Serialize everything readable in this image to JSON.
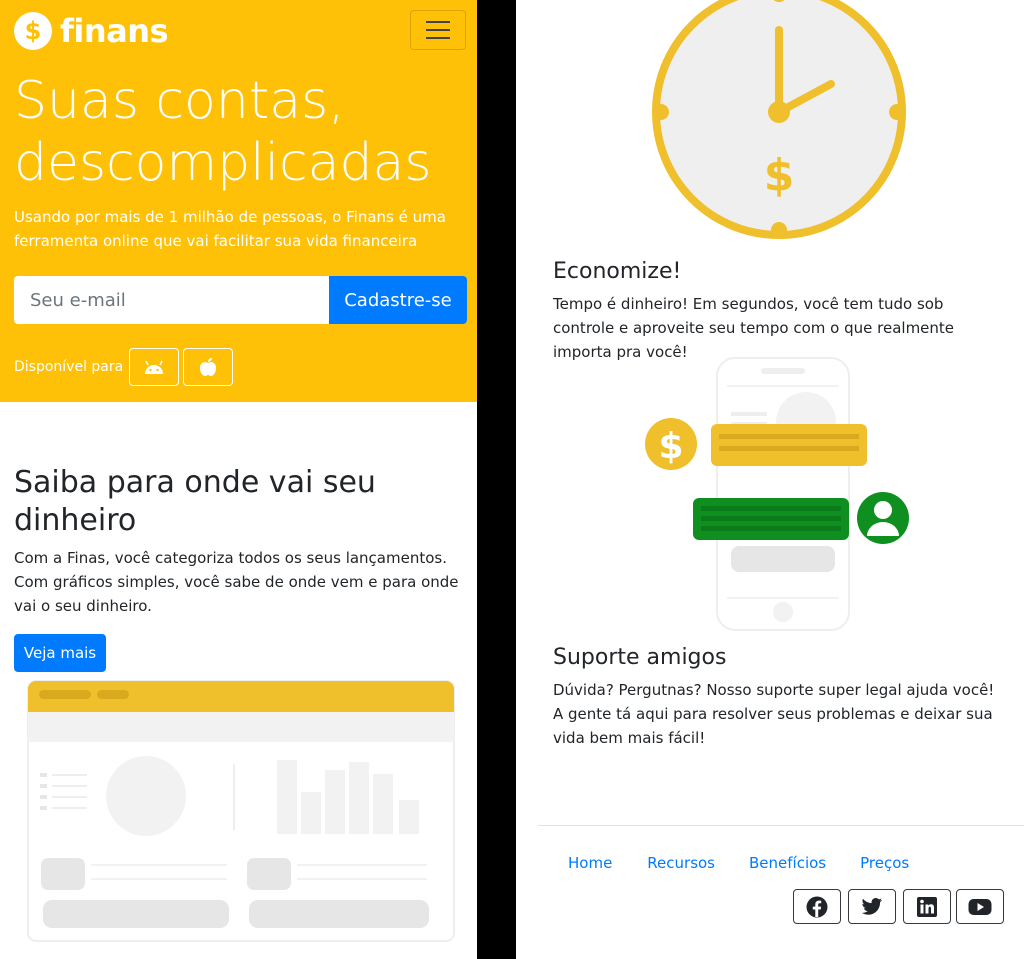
{
  "brand": {
    "name": "finans",
    "coin_symbol": "$",
    "accent": "#ffc107",
    "primary": "#007bff"
  },
  "hero": {
    "title_line1": "Suas contas,",
    "title_line2": "descomplicadas",
    "subtitle": "Usando por mais de 1 milhão de pessoas, o Finans é uma ferramenta online que vai facilitar sua vida financeira",
    "email_placeholder": "Seu e-mail",
    "signup_label": "Cadastre-se",
    "available_label": "Disponível para",
    "stores": [
      "android-icon",
      "apple-icon"
    ]
  },
  "section": {
    "title": "Saiba para onde vai seu dinheiro",
    "text": "Com a Finas, você categoriza todos os seus lançamentos. Com gráficos simples, você sabe de onde vem e para onde vai o seu dinheiro.",
    "button": "Veja mais"
  },
  "features": [
    {
      "title": "Economize!",
      "text": "Tempo é dinheiro! Em segundos, você tem tudo sob controle e aproveite seu tempo com o que realmente importa pra você!"
    },
    {
      "title": "Suporte amigos",
      "text": "Dúvida? Pergutnas? Nosso suporte super legal ajuda você! A gente tá aqui para resolver seus problemas e deixar sua vida bem mais fácil!"
    }
  ],
  "footer": {
    "nav": [
      "Home",
      "Recursos",
      "Benefícios",
      "Preços"
    ],
    "social": [
      "facebook-icon",
      "twitter-icon",
      "linkedin-icon",
      "youtube-icon"
    ]
  }
}
